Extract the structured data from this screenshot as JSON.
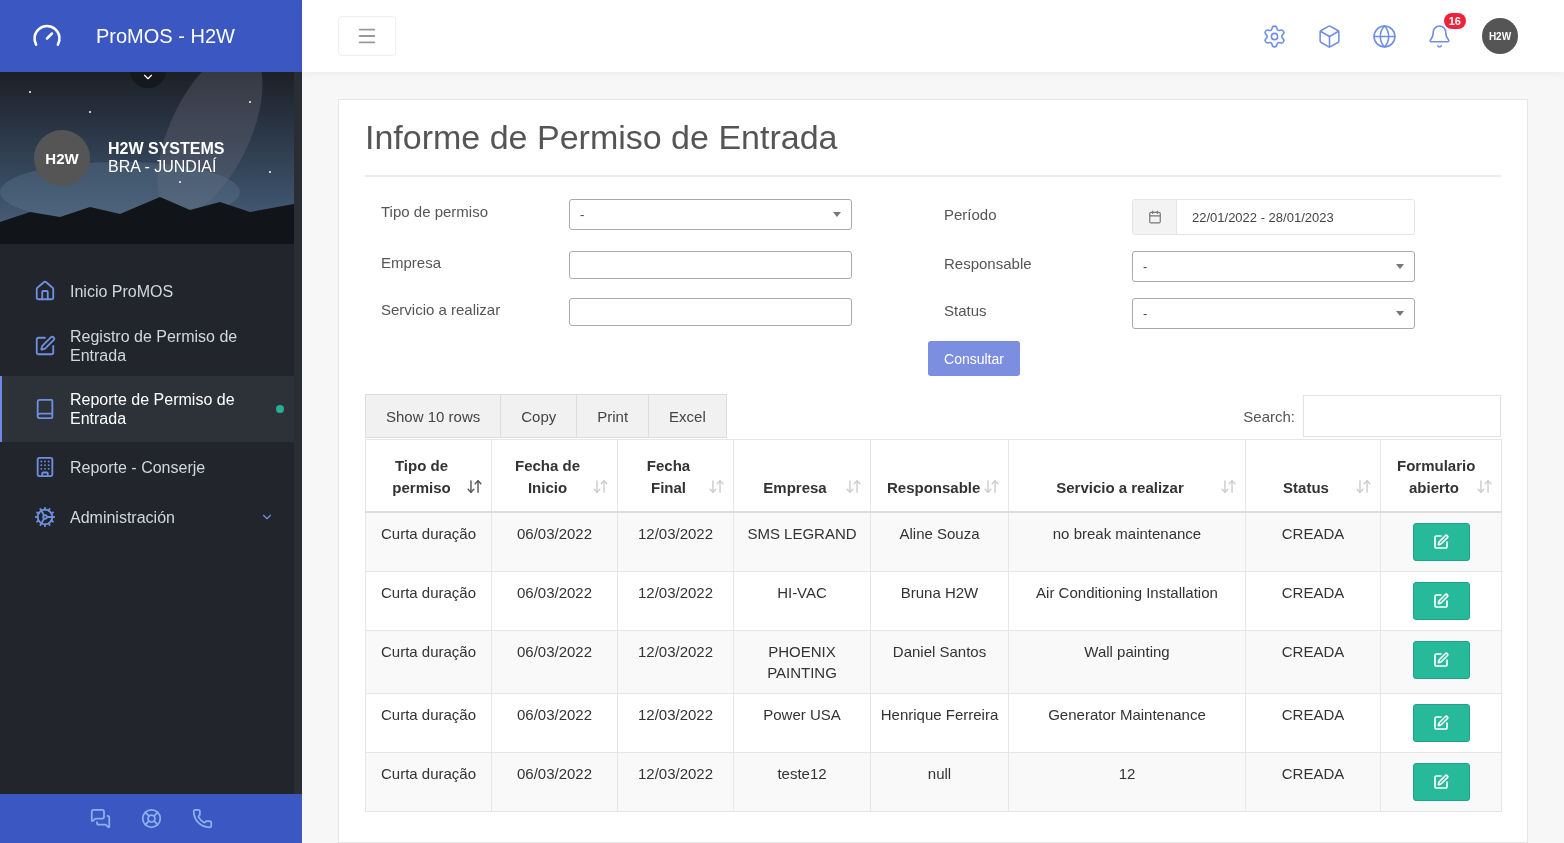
{
  "brand": {
    "title": "ProMOS - H2W"
  },
  "profile": {
    "avatar": "H2W",
    "name": "H2W SYSTEMS",
    "location": "BRA - JUNDIAÍ"
  },
  "nav": [
    {
      "label": "Inicio ProMOS",
      "kind": "link",
      "selected": false
    },
    {
      "label": "Registro de Permiso de Entrada",
      "kind": "link",
      "selected": false
    },
    {
      "label": "Reporte de Permiso de Entrada",
      "kind": "link",
      "selected": true
    },
    {
      "label": "Reporte - Conserje",
      "kind": "link",
      "selected": false
    },
    {
      "label": "Administración",
      "kind": "group",
      "selected": false
    }
  ],
  "topbar": {
    "notifications": "16",
    "avatar": "H2W"
  },
  "page": {
    "title": "Informe de Permiso de Entrada"
  },
  "filters": [
    {
      "label": "Tipo de permiso",
      "kind": "select",
      "value": "-"
    },
    {
      "label": "Período",
      "kind": "daterange",
      "value": "22/01/2022 - 28/01/2023"
    },
    {
      "label": "Empresa",
      "kind": "text"
    },
    {
      "label": "Responsable",
      "kind": "select",
      "value": "-"
    },
    {
      "label": "Servicio a realizar",
      "kind": "text"
    },
    {
      "label": "Status",
      "kind": "select",
      "value": "-"
    }
  ],
  "submit": "Consultar",
  "table_tools": {
    "buttons": [
      "Show 10 rows",
      "Copy",
      "Print",
      "Excel"
    ],
    "search_label": "Search:"
  },
  "table": {
    "columns": [
      {
        "label": "Tipo de permiso",
        "sorted": true
      },
      {
        "label": "Fecha de Inicio",
        "sorted": false
      },
      {
        "label": "Fecha Final",
        "sorted": false
      },
      {
        "label": "Empresa",
        "sorted": false
      },
      {
        "label": "Responsable",
        "sorted": false
      },
      {
        "label": "Servicio a realizar",
        "sorted": false
      },
      {
        "label": "Status",
        "sorted": false
      },
      {
        "label": "Formulario abierto",
        "sorted": false
      }
    ],
    "rows": [
      {
        "cells": [
          "Curta duração",
          "06/03/2022",
          "12/03/2022",
          "SMS LEGRAND",
          "Aline Souza",
          "no break maintenance",
          "CREADA"
        ]
      },
      {
        "cells": [
          "Curta duração",
          "06/03/2022",
          "12/03/2022",
          "HI-VAC",
          "Bruna H2W",
          "Air Conditioning Installation",
          "CREADA"
        ]
      },
      {
        "cells": [
          "Curta duração",
          "06/03/2022",
          "12/03/2022",
          "PHOENIX PAINTING",
          "Daniel Santos",
          "Wall painting",
          "CREADA"
        ]
      },
      {
        "cells": [
          "Curta duração",
          "06/03/2022",
          "12/03/2022",
          "Power USA",
          "Henrique Ferreira",
          "Generator Maintenance",
          "CREADA"
        ]
      },
      {
        "cells": [
          "Curta duração",
          "06/03/2022",
          "12/03/2022",
          "teste12",
          "null",
          "12",
          "CREADA"
        ]
      }
    ]
  }
}
